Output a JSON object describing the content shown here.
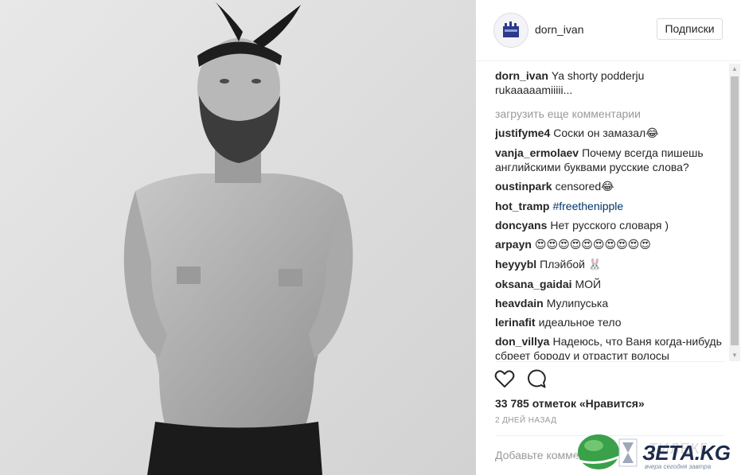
{
  "photo": {
    "description_icon": "photo-portrait",
    "background": "#e6e6e6"
  },
  "header": {
    "username": "dorn_ivan",
    "follow_label": "Подписки"
  },
  "caption": {
    "user": "dorn_ivan",
    "text": "Ya shorty podderju rukaaaaamiiiii..."
  },
  "load_more": "загрузить еще комментарии",
  "comments": [
    {
      "user": "justifyme4",
      "text": "Соски он замазал",
      "emoji": "😂"
    },
    {
      "user": "vanja_ermolaev",
      "text": "Почему всегда пишешь английскими буквами русские слова?",
      "emoji": ""
    },
    {
      "user": "oustinpark",
      "text": "censored",
      "emoji": "😂"
    },
    {
      "user": "hot_tramp",
      "text": "#freethenipple",
      "emoji": "",
      "link": true
    },
    {
      "user": "doncyans",
      "text": "Нет русского словаря )",
      "emoji": ""
    },
    {
      "user": "arpayn",
      "text": "",
      "emoji": "😍😍😍😍😍😍😍😍😍😍"
    },
    {
      "user": "heyyybl",
      "text": "Плэйбой",
      "emoji": "🐰"
    },
    {
      "user": "oksana_gaidai",
      "text": "МОЙ",
      "emoji": ""
    },
    {
      "user": "heavdain",
      "text": "Мулипуська",
      "emoji": ""
    },
    {
      "user": "lerinafit",
      "text": "идеальное тело",
      "emoji": ""
    },
    {
      "user": "don_villya",
      "text": "Надеюсь, что Ваня когда-нибудь сбреет бороду и отрастит волосы",
      "emoji": ""
    }
  ],
  "actions": {
    "like_icon": "heart-icon",
    "comment_icon": "comment-bubble-icon"
  },
  "likes": "33 785 отметок «Нравится»",
  "timestamp": "2 ДНЕЙ НАЗАД",
  "add_comment_placeholder": "Добавьте комментарий...",
  "watermark": {
    "ghost_text": "ТИЛЕКГ",
    "brand": "ЗЕТА.KG",
    "tagline": "вчера сегодня завтра",
    "colors": {
      "globe": "#3aa04a",
      "brand": "#1c2b4a"
    }
  },
  "colors": {
    "text": "#262626",
    "muted": "#999999",
    "link": "#003569",
    "border": "#dbdbdb"
  }
}
